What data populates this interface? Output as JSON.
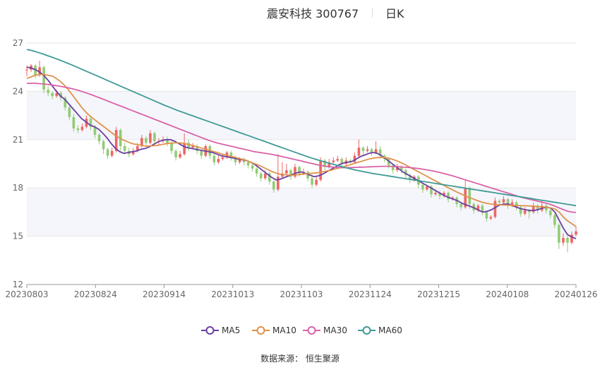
{
  "header": {
    "stock": "震安科技 300767",
    "period": "日K"
  },
  "source": "数据来源： 恒生聚源",
  "colors": {
    "up": "#ee6666",
    "down": "#91cc75",
    "MA5": "#6a3fa0",
    "MA10": "#e0914a",
    "MA30": "#d962a8",
    "MA60": "#3f9a96"
  },
  "chart_data": {
    "type": "candlestick",
    "y_ticks": [
      12,
      15,
      18,
      21,
      24,
      27
    ],
    "ylim": [
      12,
      27
    ],
    "x_ticks": [
      "20230803",
      "20230824",
      "20230914",
      "20231013",
      "20231103",
      "20231124",
      "20231215",
      "20240108",
      "20240126"
    ],
    "legend": [
      "MA5",
      "MA10",
      "MA30",
      "MA60"
    ],
    "grid": true,
    "legend_position": "bottom",
    "candles": [
      [
        25.3,
        25.35,
        24.95,
        25.6
      ],
      [
        25.35,
        25.6,
        25.2,
        25.7
      ],
      [
        25.6,
        25.0,
        24.8,
        25.7
      ],
      [
        25.0,
        25.5,
        24.9,
        25.9
      ],
      [
        25.5,
        24.1,
        23.9,
        25.6
      ],
      [
        24.1,
        23.9,
        23.7,
        24.3
      ],
      [
        23.9,
        23.7,
        23.5,
        24.0
      ],
      [
        23.7,
        23.9,
        23.6,
        24.1
      ],
      [
        23.9,
        23.6,
        23.4,
        24.0
      ],
      [
        23.6,
        23.0,
        22.8,
        23.7
      ],
      [
        23.0,
        22.4,
        22.2,
        23.1
      ],
      [
        22.4,
        21.7,
        21.5,
        22.6
      ],
      [
        21.7,
        21.6,
        21.4,
        21.9
      ],
      [
        21.6,
        21.8,
        21.5,
        22.0
      ],
      [
        21.8,
        22.3,
        21.7,
        22.5
      ],
      [
        22.3,
        21.8,
        21.6,
        22.5
      ],
      [
        21.8,
        21.3,
        21.1,
        21.9
      ],
      [
        21.3,
        20.9,
        20.7,
        21.4
      ],
      [
        20.9,
        20.4,
        20.1,
        21.0
      ],
      [
        20.4,
        20.0,
        19.8,
        20.5
      ],
      [
        20.0,
        20.3,
        19.9,
        20.5
      ],
      [
        20.3,
        21.6,
        20.2,
        21.8
      ],
      [
        21.6,
        20.6,
        20.3,
        21.7
      ],
      [
        20.6,
        20.3,
        20.1,
        20.8
      ],
      [
        20.3,
        20.1,
        19.9,
        20.5
      ],
      [
        20.1,
        20.3,
        20.0,
        20.5
      ],
      [
        20.3,
        20.6,
        20.2,
        20.8
      ],
      [
        20.6,
        21.1,
        20.5,
        21.3
      ],
      [
        21.1,
        20.8,
        20.6,
        21.2
      ],
      [
        20.8,
        21.4,
        20.7,
        21.6
      ],
      [
        21.4,
        20.9,
        20.7,
        21.5
      ],
      [
        20.9,
        20.9,
        20.7,
        21.1
      ],
      [
        20.9,
        21.0,
        20.8,
        21.2
      ],
      [
        21.0,
        20.8,
        20.6,
        21.2
      ],
      [
        20.8,
        20.3,
        20.1,
        20.9
      ],
      [
        20.3,
        19.9,
        19.7,
        20.4
      ],
      [
        19.9,
        20.1,
        19.8,
        20.3
      ],
      [
        20.1,
        20.8,
        20.0,
        21.4
      ],
      [
        20.8,
        20.5,
        20.3,
        21.0
      ],
      [
        20.5,
        20.6,
        20.4,
        20.8
      ],
      [
        20.6,
        20.3,
        20.1,
        20.7
      ],
      [
        20.3,
        20.0,
        19.8,
        20.4
      ],
      [
        20.0,
        20.6,
        19.9,
        20.7
      ],
      [
        20.6,
        20.0,
        19.8,
        20.7
      ],
      [
        20.0,
        19.6,
        19.4,
        20.1
      ],
      [
        19.6,
        19.8,
        19.5,
        20.0
      ],
      [
        19.8,
        19.9,
        19.7,
        20.1
      ],
      [
        19.9,
        20.2,
        19.8,
        20.3
      ],
      [
        20.2,
        19.9,
        19.7,
        20.3
      ],
      [
        19.9,
        19.6,
        19.4,
        20.0
      ],
      [
        19.6,
        19.8,
        19.5,
        19.9
      ],
      [
        19.8,
        19.6,
        19.4,
        19.9
      ],
      [
        19.6,
        19.4,
        19.2,
        19.7
      ],
      [
        19.4,
        19.2,
        19.0,
        19.5
      ],
      [
        19.2,
        18.9,
        18.7,
        19.3
      ],
      [
        18.9,
        18.6,
        18.4,
        19.0
      ],
      [
        18.6,
        18.9,
        18.5,
        19.1
      ],
      [
        18.9,
        18.4,
        18.2,
        19.0
      ],
      [
        18.4,
        17.9,
        17.7,
        18.5
      ],
      [
        17.9,
        18.7,
        17.8,
        20.1
      ],
      [
        18.7,
        18.9,
        18.6,
        19.6
      ],
      [
        18.9,
        19.1,
        18.8,
        19.5
      ],
      [
        19.1,
        18.7,
        18.5,
        19.2
      ],
      [
        18.7,
        19.3,
        18.6,
        19.5
      ],
      [
        19.3,
        18.9,
        18.7,
        19.4
      ],
      [
        18.9,
        19.0,
        18.8,
        19.2
      ],
      [
        19.0,
        18.6,
        18.4,
        19.1
      ],
      [
        18.6,
        18.2,
        18.0,
        18.7
      ],
      [
        18.2,
        18.5,
        18.1,
        18.7
      ],
      [
        18.5,
        19.7,
        18.4,
        19.9
      ],
      [
        19.7,
        19.3,
        19.1,
        19.8
      ],
      [
        19.3,
        19.6,
        19.2,
        19.8
      ],
      [
        19.6,
        19.7,
        19.5,
        19.9
      ],
      [
        19.7,
        19.8,
        19.6,
        20.0
      ],
      [
        19.8,
        19.5,
        19.3,
        19.9
      ],
      [
        19.5,
        19.7,
        19.4,
        19.9
      ],
      [
        19.7,
        19.6,
        19.5,
        19.8
      ],
      [
        19.6,
        20.0,
        19.5,
        20.2
      ],
      [
        20.0,
        20.5,
        19.9,
        21.0
      ],
      [
        20.5,
        20.3,
        20.0,
        20.6
      ],
      [
        20.3,
        20.4,
        20.2,
        20.6
      ],
      [
        20.4,
        20.2,
        20.0,
        20.5
      ],
      [
        20.2,
        20.4,
        20.1,
        20.9
      ],
      [
        20.4,
        20.0,
        19.8,
        20.6
      ],
      [
        20.0,
        19.8,
        19.6,
        20.1
      ],
      [
        19.8,
        19.4,
        19.2,
        19.9
      ],
      [
        19.4,
        19.1,
        18.9,
        19.5
      ],
      [
        19.1,
        19.3,
        19.0,
        19.5
      ],
      [
        19.3,
        19.1,
        18.9,
        19.4
      ],
      [
        19.1,
        18.8,
        18.6,
        19.2
      ],
      [
        18.8,
        18.5,
        18.3,
        18.9
      ],
      [
        18.5,
        18.7,
        18.4,
        18.8
      ],
      [
        18.7,
        18.2,
        18.0,
        18.8
      ],
      [
        18.2,
        17.9,
        17.7,
        18.3
      ],
      [
        17.9,
        18.1,
        17.8,
        18.2
      ],
      [
        18.1,
        17.6,
        17.4,
        18.2
      ],
      [
        17.6,
        17.7,
        17.5,
        17.9
      ],
      [
        17.7,
        17.5,
        17.3,
        17.8
      ],
      [
        17.5,
        17.7,
        17.4,
        17.8
      ],
      [
        17.7,
        17.3,
        17.1,
        17.8
      ],
      [
        17.3,
        17.4,
        17.2,
        17.5
      ],
      [
        17.4,
        17.0,
        16.8,
        17.5
      ],
      [
        17.0,
        16.8,
        16.6,
        17.1
      ],
      [
        16.8,
        18.0,
        16.7,
        18.5
      ],
      [
        18.0,
        17.0,
        16.7,
        18.1
      ],
      [
        17.0,
        16.6,
        16.4,
        17.1
      ],
      [
        16.6,
        16.9,
        16.5,
        17.0
      ],
      [
        16.9,
        16.5,
        16.3,
        17.0
      ],
      [
        16.5,
        16.1,
        15.9,
        16.6
      ],
      [
        16.1,
        16.2,
        16.0,
        16.3
      ],
      [
        16.2,
        17.2,
        16.1,
        17.4
      ],
      [
        17.2,
        17.1,
        16.9,
        17.3
      ],
      [
        17.1,
        17.3,
        17.0,
        17.5
      ],
      [
        17.3,
        16.9,
        16.7,
        17.4
      ],
      [
        16.9,
        17.1,
        16.8,
        17.3
      ],
      [
        17.1,
        16.8,
        16.6,
        17.2
      ],
      [
        16.8,
        16.4,
        16.2,
        16.9
      ],
      [
        16.4,
        16.6,
        16.3,
        16.8
      ],
      [
        16.6,
        16.5,
        16.1,
        16.7
      ],
      [
        16.5,
        16.9,
        16.4,
        17.1
      ],
      [
        16.9,
        16.6,
        16.4,
        17.0
      ],
      [
        16.6,
        16.9,
        16.5,
        17.2
      ],
      [
        16.9,
        16.6,
        16.4,
        17.0
      ],
      [
        16.6,
        16.3,
        16.1,
        16.7
      ],
      [
        16.3,
        15.7,
        15.5,
        16.4
      ],
      [
        15.7,
        14.6,
        14.2,
        15.8
      ],
      [
        14.6,
        14.9,
        14.4,
        15.2
      ],
      [
        14.9,
        14.6,
        14.0,
        15.0
      ],
      [
        14.6,
        15.1,
        14.5,
        15.3
      ],
      [
        15.1,
        15.3,
        15.0,
        15.6
      ]
    ],
    "ma": {
      "MA5": [
        25.5,
        25.45,
        25.35,
        25.2,
        25.0,
        24.7,
        24.35,
        24.0,
        23.7,
        23.5,
        23.2,
        22.9,
        22.6,
        22.3,
        22.1,
        21.9,
        21.8,
        21.65,
        21.4,
        21.1,
        20.75,
        20.45,
        20.25,
        20.15,
        20.2,
        20.25,
        20.3,
        20.4,
        20.45,
        20.55,
        20.7,
        20.85,
        20.95,
        21.0,
        21.0,
        20.9,
        20.75,
        20.6,
        20.5,
        20.45,
        20.4,
        20.35,
        20.3,
        20.25,
        20.2,
        20.1,
        20.0,
        19.95,
        19.9,
        19.85,
        19.8,
        19.75,
        19.7,
        19.6,
        19.45,
        19.25,
        19.05,
        18.85,
        18.65,
        18.5,
        18.55,
        18.65,
        18.75,
        18.85,
        18.95,
        19.0,
        18.9,
        18.8,
        18.7,
        18.75,
        18.85,
        19.0,
        19.15,
        19.3,
        19.45,
        19.55,
        19.6,
        19.65,
        19.8,
        19.95,
        20.05,
        20.15,
        20.2,
        20.15,
        20.0,
        19.8,
        19.6,
        19.4,
        19.2,
        19.0,
        18.85,
        18.7,
        18.55,
        18.4,
        18.25,
        18.1,
        17.95,
        17.8,
        17.65,
        17.5,
        17.4,
        17.3,
        17.2,
        17.05,
        16.95,
        16.85,
        16.75,
        16.6,
        16.5,
        16.55,
        16.65,
        16.8,
        16.95,
        17.0,
        17.0,
        16.9,
        16.8,
        16.7,
        16.65,
        16.6,
        16.6,
        16.65,
        16.75,
        16.8,
        16.75,
        16.5,
        16.0,
        15.5,
        15.1,
        14.95,
        14.85
      ],
      "MA10": [
        24.8,
        24.9,
        25.0,
        25.05,
        25.05,
        25.0,
        24.95,
        24.8,
        24.6,
        24.35,
        24.05,
        23.7,
        23.35,
        23.0,
        22.7,
        22.45,
        22.25,
        22.05,
        21.85,
        21.65,
        21.45,
        21.25,
        21.1,
        20.95,
        20.85,
        20.75,
        20.7,
        20.65,
        20.6,
        20.6,
        20.62,
        20.65,
        20.7,
        20.75,
        20.78,
        20.8,
        20.8,
        20.78,
        20.72,
        20.65,
        20.58,
        20.5,
        20.42,
        20.35,
        20.28,
        20.2,
        20.12,
        20.05,
        19.98,
        19.92,
        19.85,
        19.78,
        19.7,
        19.6,
        19.5,
        19.4,
        19.28,
        19.15,
        19.02,
        18.92,
        18.85,
        18.82,
        18.8,
        18.8,
        18.82,
        18.85,
        18.88,
        18.9,
        18.92,
        18.95,
        19.0,
        19.05,
        19.1,
        19.18,
        19.25,
        19.32,
        19.4,
        19.48,
        19.56,
        19.64,
        19.72,
        19.8,
        19.85,
        19.88,
        19.9,
        19.88,
        19.82,
        19.74,
        19.64,
        19.52,
        19.38,
        19.24,
        19.1,
        18.96,
        18.82,
        18.68,
        18.54,
        18.4,
        18.26,
        18.12,
        17.98,
        17.85,
        17.72,
        17.6,
        17.48,
        17.38,
        17.28,
        17.18,
        17.1,
        17.04,
        17.0,
        16.97,
        16.95,
        16.94,
        16.93,
        16.92,
        16.91,
        16.9,
        16.89,
        16.88,
        16.86,
        16.84,
        16.82,
        16.8,
        16.76,
        16.7,
        16.5,
        16.2,
        15.95,
        15.78,
        15.6
      ],
      "MA30": [
        24.5,
        24.5,
        24.5,
        24.48,
        24.46,
        24.43,
        24.4,
        24.36,
        24.32,
        24.27,
        24.22,
        24.16,
        24.1,
        24.02,
        23.94,
        23.85,
        23.76,
        23.66,
        23.56,
        23.46,
        23.36,
        23.26,
        23.16,
        23.06,
        22.96,
        22.86,
        22.76,
        22.66,
        22.56,
        22.46,
        22.36,
        22.26,
        22.16,
        22.06,
        21.96,
        21.86,
        21.76,
        21.66,
        21.56,
        21.46,
        21.36,
        21.26,
        21.16,
        21.06,
        20.96,
        20.88,
        20.8,
        20.74,
        20.68,
        20.62,
        20.56,
        20.5,
        20.44,
        20.38,
        20.32,
        20.26,
        20.22,
        20.18,
        20.14,
        20.1,
        20.05,
        20.0,
        19.94,
        19.88,
        19.82,
        19.76,
        19.7,
        19.64,
        19.58,
        19.52,
        19.46,
        19.4,
        19.36,
        19.32,
        19.3,
        19.28,
        19.26,
        19.26,
        19.26,
        19.27,
        19.28,
        19.29,
        19.3,
        19.31,
        19.32,
        19.33,
        19.34,
        19.34,
        19.34,
        19.33,
        19.32,
        19.3,
        19.28,
        19.26,
        19.23,
        19.2,
        19.16,
        19.12,
        19.07,
        19.02,
        18.96,
        18.9,
        18.83,
        18.76,
        18.68,
        18.6,
        18.52,
        18.44,
        18.36,
        18.28,
        18.2,
        18.12,
        18.04,
        17.96,
        17.88,
        17.8,
        17.72,
        17.64,
        17.56,
        17.48,
        17.4,
        17.34,
        17.28,
        17.22,
        17.16,
        17.1,
        17.04,
        16.96,
        16.86,
        16.75,
        16.65,
        16.55,
        16.5,
        16.48
      ],
      "MA60": [
        26.6,
        26.55,
        26.48,
        26.4,
        26.32,
        26.23,
        26.14,
        26.05,
        25.95,
        25.85,
        25.75,
        25.65,
        25.54,
        25.43,
        25.32,
        25.21,
        25.1,
        24.99,
        24.88,
        24.77,
        24.66,
        24.55,
        24.44,
        24.33,
        24.22,
        24.11,
        24.0,
        23.89,
        23.78,
        23.67,
        23.56,
        23.45,
        23.34,
        23.23,
        23.12,
        23.02,
        22.92,
        22.82,
        22.73,
        22.64,
        22.55,
        22.46,
        22.37,
        22.28,
        22.19,
        22.1,
        22.01,
        21.92,
        21.83,
        21.74,
        21.65,
        21.56,
        21.47,
        21.38,
        21.29,
        21.2,
        21.11,
        21.02,
        20.93,
        20.84,
        20.75,
        20.66,
        20.57,
        20.48,
        20.39,
        20.3,
        20.21,
        20.12,
        20.03,
        19.94,
        19.86,
        19.78,
        19.7,
        19.63,
        19.56,
        19.49,
        19.42,
        19.35,
        19.28,
        19.22,
        19.16,
        19.1,
        19.05,
        19.0,
        18.95,
        18.9,
        18.86,
        18.82,
        18.78,
        18.74,
        18.7,
        18.66,
        18.62,
        18.58,
        18.54,
        18.5,
        18.46,
        18.42,
        18.38,
        18.34,
        18.3,
        18.26,
        18.22,
        18.18,
        18.14,
        18.1,
        18.06,
        18.02,
        17.98,
        17.94,
        17.9,
        17.86,
        17.82,
        17.78,
        17.74,
        17.7,
        17.66,
        17.62,
        17.58,
        17.54,
        17.5,
        17.46,
        17.42,
        17.38,
        17.34,
        17.3,
        17.26,
        17.22,
        17.18,
        17.14,
        17.1,
        17.06,
        17.02,
        16.98,
        16.94,
        16.9
      ]
    }
  }
}
